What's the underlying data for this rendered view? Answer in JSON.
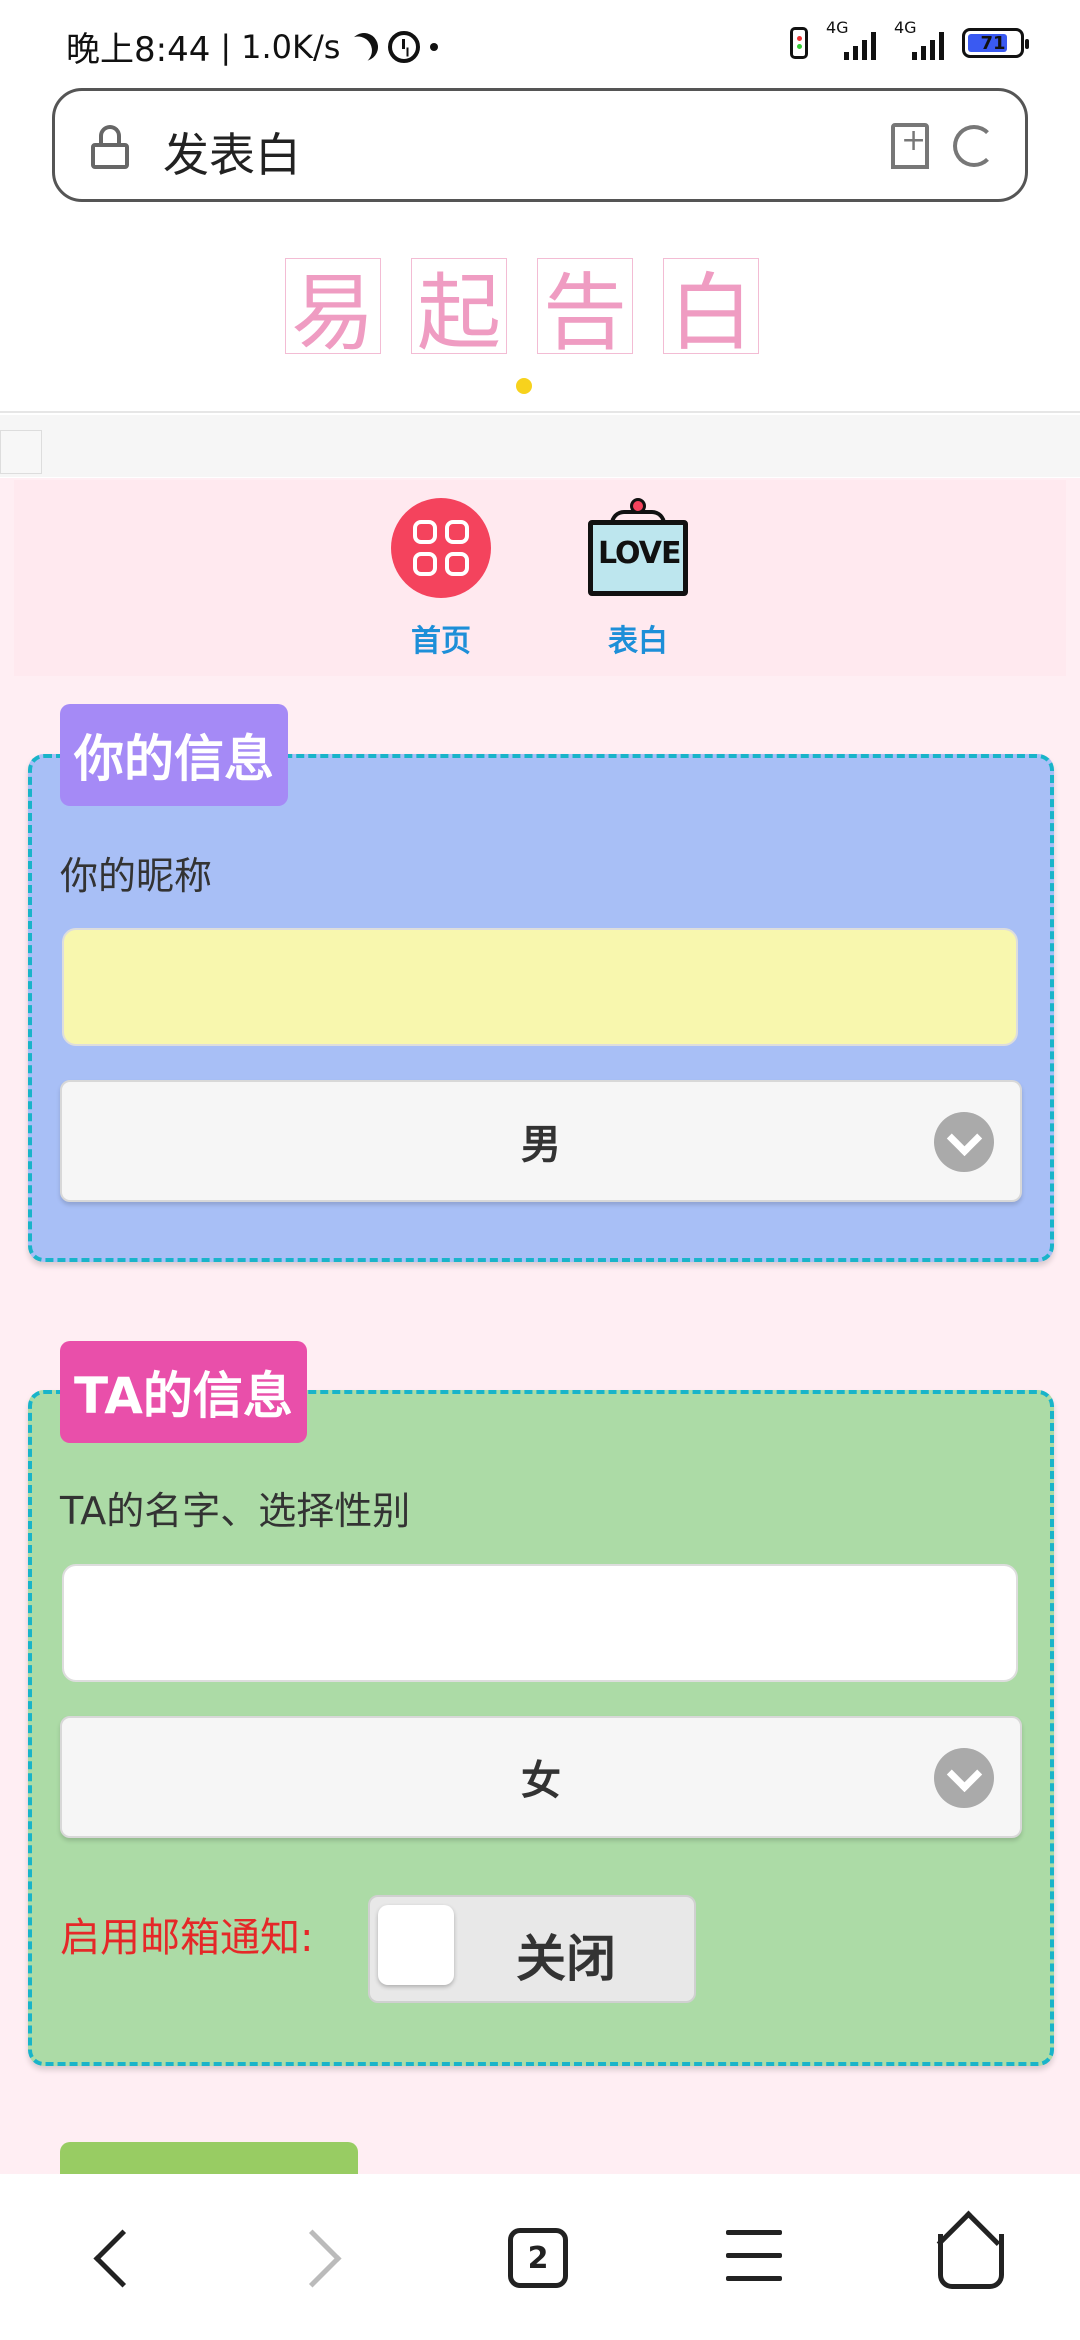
{
  "status_bar": {
    "time": "晚上8:44",
    "net_speed": "1.0K/s",
    "signal1": "4G",
    "signal2": "4G",
    "battery": "71"
  },
  "url_bar": {
    "title": "发表白"
  },
  "logo": {
    "chars": [
      "易",
      "起",
      "告",
      "白"
    ]
  },
  "nav": {
    "home_label": "首页",
    "confess_label": "表白",
    "love_sign": "LOVE"
  },
  "you_card": {
    "tag": "你的信息",
    "nickname_label": "你的昵称",
    "nickname_value": "",
    "gender_selected": "男"
  },
  "ta_card": {
    "tag": "TA的信息",
    "name_label": "TA的名字、选择性别",
    "name_value": "",
    "gender_selected": "女",
    "email_label": "启用邮箱通知:",
    "email_toggle_state": "关闭"
  },
  "bottom_nav": {
    "tab_count": "2"
  },
  "colors": {
    "accent_pink": "#f4435d",
    "you_card_bg": "#a8bff6",
    "ta_card_bg": "#acdba6",
    "dashed_border": "#19b4c9"
  }
}
